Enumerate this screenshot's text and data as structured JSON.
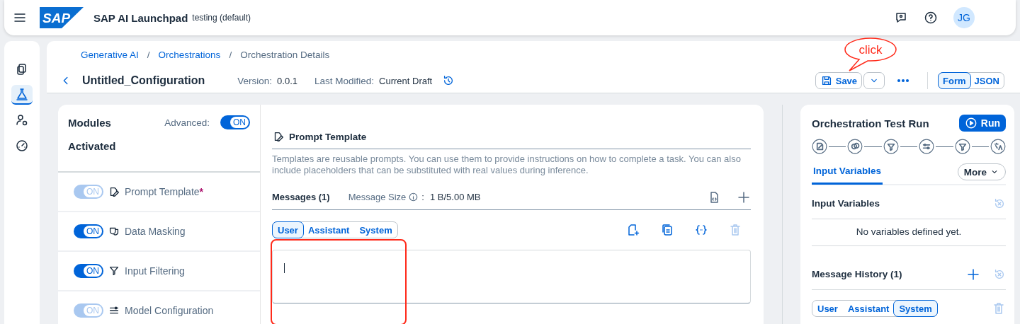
{
  "header": {
    "logo": "SAP",
    "title": "SAP AI Launchpad",
    "subtitle": "testing (default)",
    "avatar": "JG"
  },
  "nav_rail": [
    {
      "selected": false
    },
    {
      "selected": true
    },
    {
      "selected": false
    },
    {
      "selected": false
    }
  ],
  "breadcrumb": {
    "items": [
      {
        "label": "Generative AI",
        "kind": "link"
      },
      {
        "label": "Orchestrations",
        "kind": "link"
      },
      {
        "label": "Orchestration Details",
        "kind": "current"
      }
    ],
    "separators": [
      "/",
      "/"
    ]
  },
  "title_bar": {
    "title": "Untitled_Configuration",
    "version_label": "Version:",
    "version": "0.0.1",
    "modified_label": "Last Modified:",
    "modified": "Current Draft",
    "save_label": "Save",
    "view_modes": [
      {
        "label": "Form",
        "selected": true
      },
      {
        "label": "JSON",
        "selected": false
      }
    ]
  },
  "annotation": {
    "callout": "click"
  },
  "modules": {
    "title": "Modules",
    "advanced_label": "Advanced:",
    "advanced": {
      "on": true,
      "text": "ON"
    },
    "section": "Activated",
    "items": [
      {
        "label": "Prompt Template",
        "required_mark": "*",
        "on": true,
        "disabled": true,
        "toggle_text": "ON"
      },
      {
        "label": "Data Masking",
        "on": true,
        "disabled": false,
        "toggle_text": "ON"
      },
      {
        "label": "Input Filtering",
        "on": true,
        "disabled": false,
        "toggle_text": "ON"
      },
      {
        "label": "Model Configuration",
        "on": true,
        "disabled": true,
        "toggle_text": "ON"
      }
    ]
  },
  "prompt_template": {
    "title": "Prompt Template",
    "description": "Templates are reusable prompts. You can use them to provide instructions on how to complete a task. You can also include placeholders that can be substituted with real values during inference.",
    "messages_label": "Messages (1)",
    "size_label": "Message Size",
    "size_separator": ":",
    "size_value": "1 B/5.00 MB",
    "roles": [
      {
        "label": "User",
        "selected": true
      },
      {
        "label": "Assistant",
        "selected": false
      },
      {
        "label": "System",
        "selected": false
      }
    ]
  },
  "test_run": {
    "title": "Orchestration Test Run",
    "run_label": "Run",
    "tabs": [
      {
        "label": "Input Variables",
        "selected": true
      }
    ],
    "more_label": "More",
    "input_variables": {
      "title": "Input Variables",
      "empty_text": "No variables defined yet."
    },
    "message_history": {
      "title": "Message History (1)",
      "roles": [
        {
          "label": "User",
          "selected": false
        },
        {
          "label": "Assistant",
          "selected": false
        },
        {
          "label": "System",
          "selected": true
        }
      ]
    }
  }
}
